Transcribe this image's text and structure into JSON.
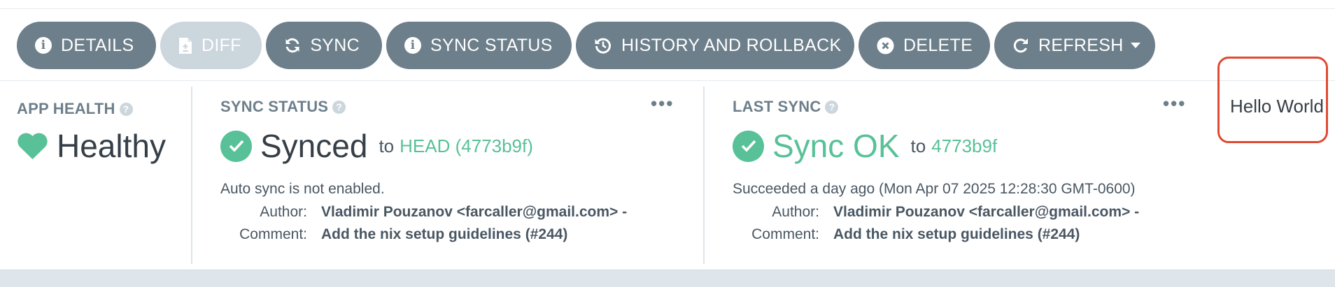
{
  "toolbar": {
    "buttons": [
      {
        "label": "DETAILS",
        "icon": "info-circle-icon",
        "enabled": true
      },
      {
        "label": "DIFF",
        "icon": "file-diff-icon",
        "enabled": false
      },
      {
        "label": "SYNC",
        "icon": "sync-icon",
        "enabled": true
      },
      {
        "label": "SYNC STATUS",
        "icon": "info-circle-icon",
        "enabled": true
      },
      {
        "label": "HISTORY AND ROLLBACK",
        "icon": "history-icon",
        "enabled": true
      },
      {
        "label": "DELETE",
        "icon": "times-circle-icon",
        "enabled": true
      },
      {
        "label": "REFRESH",
        "icon": "redo-icon",
        "enabled": true,
        "dropdown": true
      }
    ]
  },
  "app_health": {
    "label": "APP HEALTH",
    "status": "Healthy",
    "icon": "heart-icon",
    "color": "#58c197"
  },
  "sync_status": {
    "label": "SYNC STATUS",
    "status": "Synced",
    "to_text": "to",
    "revision": "HEAD (4773b9f)",
    "icon": "check-circle-icon",
    "auto_sync_text": "Auto sync is not enabled.",
    "author_key": "Author:",
    "author_value": "Vladimir Pouzanov <farcaller@gmail.com> -",
    "comment_key": "Comment:",
    "comment_value": "Add the nix setup guidelines (#244)"
  },
  "last_sync": {
    "label": "LAST SYNC",
    "status": "Sync OK",
    "to_text": "to",
    "revision": "4773b9f",
    "icon": "check-circle-icon",
    "succeeded_text": "Succeeded a day ago (Mon Apr 07 2025 12:28:30 GMT-0600)",
    "author_key": "Author:",
    "author_value": "Vladimir Pouzanov <farcaller@gmail.com> -",
    "comment_key": "Comment:",
    "comment_value": "Add the nix setup guidelines (#244)"
  },
  "extension": {
    "text": "Hello World"
  },
  "colors": {
    "button_bg": "#6d7f8b",
    "button_disabled_bg": "#ccd6dd",
    "success": "#58c197",
    "highlight_border": "#e04a34"
  }
}
